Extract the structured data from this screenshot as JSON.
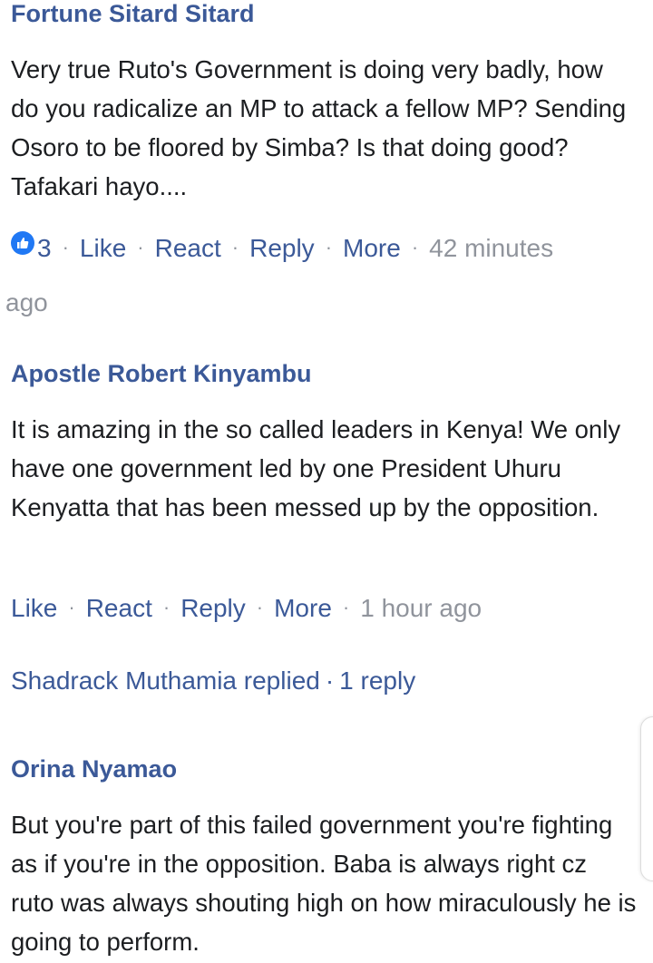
{
  "comments": [
    {
      "author": "Fortune Sitard Sitard",
      "text": "Very true Ruto's Government  is doing very badly, how do you radicalize an MP to attack a fellow MP? Sending Osoro to be floored by Simba? Is that doing good? Tafakari hayo....",
      "reaction_icon": "like-reaction-icon",
      "reaction_count": "3",
      "like_label": "Like",
      "react_label": "React",
      "reply_label": "Reply",
      "more_label": "More",
      "time_part1": "42 minutes",
      "time_part2": "ago"
    },
    {
      "author": "Apostle Robert Kinyambu",
      "text": "It is amazing in the so called leaders in Kenya!  We only have one government led by one President Uhuru Kenyatta that has been messed up by the opposition.",
      "like_label": "Like",
      "react_label": "React",
      "reply_label": "Reply",
      "more_label": "More",
      "time": "1 hour ago",
      "replies_preview": "Shadrack Muthamia replied",
      "replies_count": "1 reply"
    },
    {
      "author": "Orina Nyamao",
      "text": "But you're part of this failed government you're fighting as if you're in the opposition. Baba is always right cz ruto was always shouting high on how miraculously he is going to perform."
    }
  ],
  "colors": {
    "link": "#3b5998",
    "meta": "#90949c",
    "text": "#1c1e21",
    "like_badge": "#2078f4"
  }
}
